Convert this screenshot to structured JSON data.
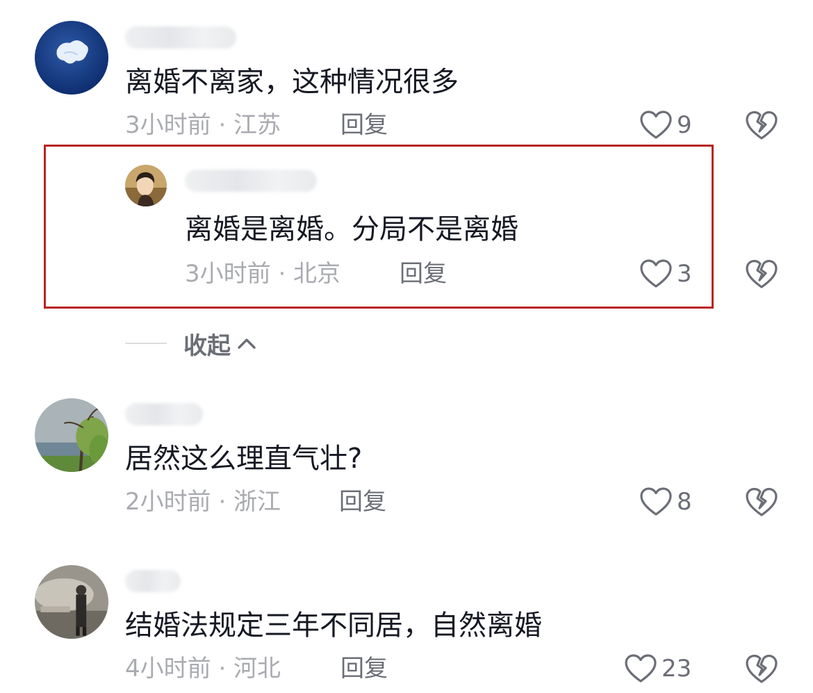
{
  "comments": [
    {
      "text": "离婚不离家，这种情况很多",
      "meta": "3小时前 · 江苏",
      "reply_label": "回复",
      "likes": "9",
      "avatar_icon": "avatar-blue-sky"
    },
    {
      "text": "离婚是离婚。分局不是离婚",
      "meta": "3小时前 · 北京",
      "reply_label": "回复",
      "likes": "3",
      "avatar_icon": "avatar-person",
      "highlighted": true,
      "highlight_color": "#b92222"
    },
    {
      "text": "居然这么理直气壮?",
      "meta": "2小时前 · 浙江",
      "reply_label": "回复",
      "likes": "8",
      "avatar_icon": "avatar-lake-tree"
    },
    {
      "text": "结婚法规定三年不同居，自然离婚",
      "meta": "4小时前 · 河北",
      "reply_label": "回复",
      "likes": "23",
      "avatar_icon": "avatar-standing-man"
    }
  ],
  "collapse": {
    "label": "收起"
  },
  "icons": {
    "like": "heart-outline-icon",
    "dislike": "broken-heart-icon",
    "collapse": "chevron-up-icon"
  },
  "colors": {
    "text": "#161823",
    "meta": "#a9abb0",
    "reply": "#6b6e76",
    "highlight": "#b92222"
  }
}
